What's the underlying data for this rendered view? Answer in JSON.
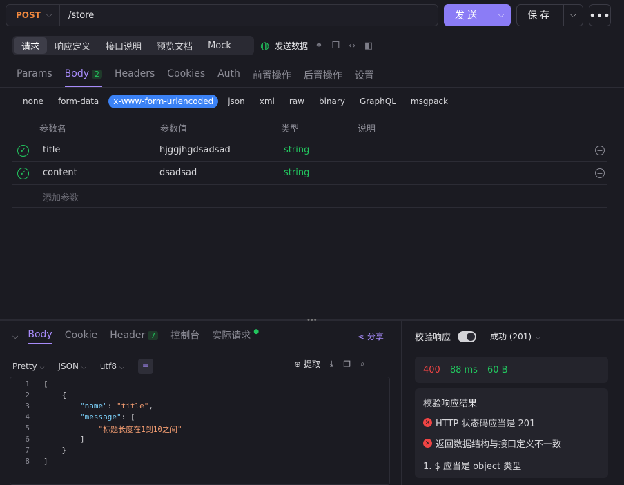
{
  "request": {
    "method": "POST",
    "url": "/store",
    "send_label": "发送",
    "save_label": "保存",
    "more_label": "•••"
  },
  "view_tabs": [
    "请求",
    "响应定义",
    "接口说明",
    "预览文档",
    "Mock"
  ],
  "send_data_label": "发送数据",
  "param_tabs": {
    "params": "Params",
    "body": "Body",
    "body_count": "2",
    "headers": "Headers",
    "cookies": "Cookies",
    "auth": "Auth",
    "pre": "前置操作",
    "post": "后置操作",
    "settings": "设置"
  },
  "body_types": [
    "none",
    "form-data",
    "x-www-form-urlencoded",
    "json",
    "xml",
    "raw",
    "binary",
    "GraphQL",
    "msgpack"
  ],
  "table_headers": {
    "name": "参数名",
    "value": "参数值",
    "type": "类型",
    "desc": "说明"
  },
  "params": [
    {
      "name": "title",
      "value": "hjggjhgdsadsad",
      "type": "string"
    },
    {
      "name": "content",
      "value": "dsadsad",
      "type": "string"
    }
  ],
  "add_param_placeholder": "添加参数",
  "response_tabs": {
    "body": "Body",
    "cookie": "Cookie",
    "header": "Header",
    "header_count": "7",
    "console": "控制台",
    "actual": "实际请求"
  },
  "share_label": "分享",
  "format": {
    "pretty": "Pretty",
    "lang": "JSON",
    "encoding": "utf8"
  },
  "extract_label": "提取",
  "code_lines": [
    {
      "n": "1",
      "text": "["
    },
    {
      "n": "2",
      "text": "    {"
    },
    {
      "n": "3",
      "key": "\"name\"",
      "value": "\"title\"",
      "indent": "        ",
      "suffix": ","
    },
    {
      "n": "4",
      "key": "\"message\"",
      "value": "[",
      "indent": "        ",
      "suffix": ""
    },
    {
      "n": "5",
      "text": "            \"标题长度在1到10之间\"",
      "isStr": true
    },
    {
      "n": "6",
      "text": "        ]"
    },
    {
      "n": "7",
      "text": "    }"
    },
    {
      "n": "8",
      "text": "]"
    }
  ],
  "verify": {
    "label": "校验响应",
    "status_text": "成功 (201)",
    "code": "400",
    "time": "88 ms",
    "size": "60 B",
    "result_title": "校验响应结果",
    "errors": [
      "HTTP 状态码应当是 201",
      "返回数据结构与接口定义不一致"
    ],
    "detail": "1. $ 应当是 object 类型"
  }
}
